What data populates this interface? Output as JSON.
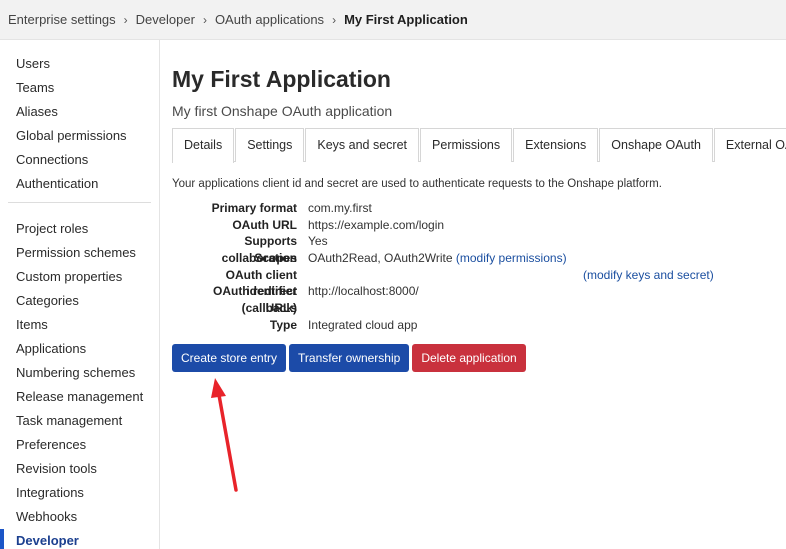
{
  "breadcrumb": {
    "items": [
      "Enterprise settings",
      "Developer",
      "OAuth applications"
    ],
    "current": "My First Application",
    "separator": "›"
  },
  "sidebar": {
    "group1": [
      "Users",
      "Teams",
      "Aliases",
      "Global permissions",
      "Connections",
      "Authentication"
    ],
    "group2": [
      "Project roles",
      "Permission schemes",
      "Custom properties",
      "Categories",
      "Items",
      "Applications",
      "Numbering schemes",
      "Release management",
      "Task management",
      "Preferences",
      "Revision tools",
      "Integrations",
      "Webhooks"
    ],
    "active": "Developer"
  },
  "page": {
    "title": "My First Application",
    "subtitle": "My first Onshape OAuth application"
  },
  "tabs": [
    {
      "label": "Details",
      "active": true
    },
    {
      "label": "Settings",
      "active": false
    },
    {
      "label": "Keys and secret",
      "active": false
    },
    {
      "label": "Permissions",
      "active": false
    },
    {
      "label": "Extensions",
      "active": false
    },
    {
      "label": "Onshape OAuth",
      "active": false
    },
    {
      "label": "External OAuth",
      "active": false
    }
  ],
  "details": {
    "description": "Your applications client id and secret are used to authenticate requests to the Onshape platform.",
    "primary_format_label": "Primary format",
    "primary_format": "com.my.first",
    "oauth_url_label": "OAuth URL",
    "oauth_url": "https://example.com/login",
    "supports_collab_label": "Supports collaboration",
    "supports_collab": "Yes",
    "scopes_label": "Scopes",
    "scopes": "OAuth2Read, OAuth2Write",
    "modify_permissions": "(modify permissions)",
    "client_id_label": "OAuth client identifier",
    "modify_keys": "(modify keys and secret)",
    "redirect_label": "OAuth redirect (callback)",
    "redirect": "http://localhost:8000/",
    "urls_label": "URLs",
    "type_label": "Type",
    "type": "Integrated cloud app"
  },
  "actions": {
    "create_store": "Create store entry",
    "transfer": "Transfer ownership",
    "delete": "Delete application"
  },
  "colors": {
    "primary": "#1c4ba8",
    "danger": "#c9313d",
    "link": "#1b4fa0",
    "annotation_arrow": "#e8232a"
  },
  "icons": {
    "breadcrumb_separator": "chevron-right-icon",
    "annotation": "red-arrow-annotation"
  }
}
